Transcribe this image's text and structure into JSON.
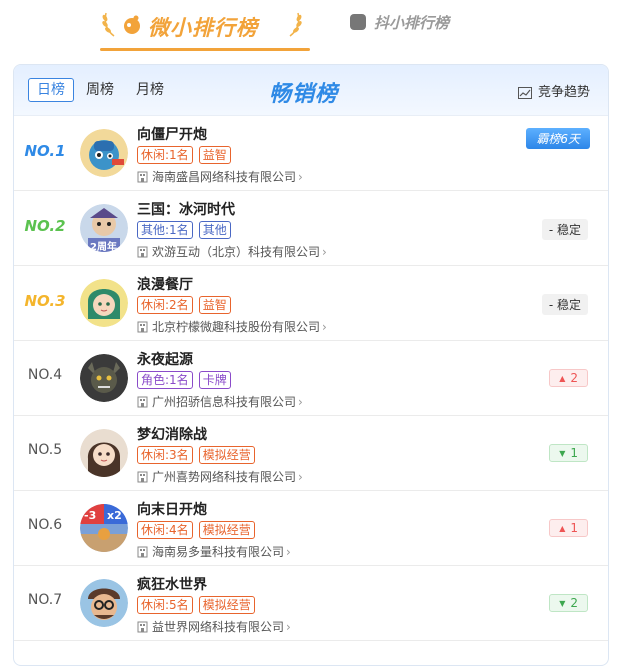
{
  "top_tabs": {
    "primary": "微小排行榜",
    "secondary": "抖小排行榜"
  },
  "header": {
    "period_tabs": [
      "日榜",
      "周榜",
      "月榜"
    ],
    "active_period": "日榜",
    "title": "畅销榜",
    "trend_label": "竞争趋势"
  },
  "rows": [
    {
      "rank": "NO.1",
      "name": "向僵尸开炮",
      "tags": [
        "休闲:1名",
        "益智"
      ],
      "company": "海南盛昌网络科技有限公司",
      "status": "霸榜6天"
    },
    {
      "rank": "NO.2",
      "name": "三国：冰河时代",
      "tags": [
        "其他:1名",
        "其他"
      ],
      "company": "欢游互动（北京）科技有限公司",
      "status": "稳定",
      "avatar_badge": "2周年"
    },
    {
      "rank": "NO.3",
      "name": "浪漫餐厅",
      "tags": [
        "休闲:2名",
        "益智"
      ],
      "company": "北京柠檬微趣科技股份有限公司",
      "status": "稳定"
    },
    {
      "rank": "NO.4",
      "name": "永夜起源",
      "tags": [
        "角色:1名",
        "卡牌"
      ],
      "company": "广州招骄信息科技有限公司",
      "status": "2"
    },
    {
      "rank": "NO.5",
      "name": "梦幻消除战",
      "tags": [
        "休闲:3名",
        "模拟经营"
      ],
      "company": "广州喜势网络科技有限公司",
      "status": "1"
    },
    {
      "rank": "NO.6",
      "name": "向末日开炮",
      "tags": [
        "休闲:4名",
        "模拟经营"
      ],
      "company": "海南易多量科技有限公司",
      "status": "1",
      "avatar_badge_a": "-3",
      "avatar_badge_b": "x2"
    },
    {
      "rank": "NO.7",
      "name": "疯狂水世界",
      "tags": [
        "休闲:5名",
        "模拟经营"
      ],
      "company": "益世界网络科技有限公司",
      "status": "2"
    }
  ],
  "colors": {
    "accent_orange": "#f2a33a",
    "accent_blue": "#2f8ae6",
    "up_red": "#e55555",
    "down_green": "#3da74f"
  }
}
